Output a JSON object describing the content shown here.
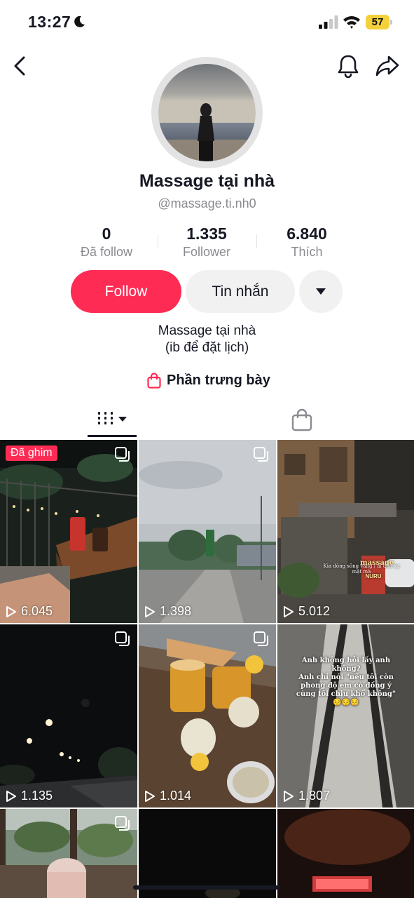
{
  "status": {
    "time": "13:27",
    "battery": "57"
  },
  "profile": {
    "name": "Massage tại nhà",
    "handle": "@massage.ti.nh0",
    "stats": [
      {
        "value": "0",
        "label": "Đã follow"
      },
      {
        "value": "1.335",
        "label": "Follower"
      },
      {
        "value": "6.840",
        "label": "Thích"
      }
    ],
    "follow_label": "Follow",
    "message_label": "Tin nhắn",
    "bio_line1": "Massage tại nhà",
    "bio_line2": "(ib để đặt lịch)",
    "showcase_label": "Phần trưng bày"
  },
  "colors": {
    "accent": "#fe2c55",
    "text": "#161823",
    "muted": "#8a8b91",
    "button_bg": "#f1f1f2"
  },
  "videos": [
    {
      "views": "6.045",
      "pinned_label": "Đã ghim",
      "multi": true
    },
    {
      "views": "1.398",
      "multi": true
    },
    {
      "views": "5.012",
      "sign_text": "massage",
      "sign_sub": "NURU",
      "caption": "Kia dòng sông vắng / ai đón xa mặt mà"
    },
    {
      "views": "1.135",
      "multi": true
    },
    {
      "views": "1.014",
      "multi": true
    },
    {
      "views": "1.807",
      "caption1": "Anh không hỏi lấy anh không?",
      "caption2": "Anh chỉ nói \"nếu tôi còn phong độ em có đồng ý cùng tôi chịu khổ không\" 😔😔😔"
    },
    {
      "views": ""
    },
    {
      "views": ""
    },
    {
      "views": ""
    }
  ],
  "icons": [
    "moon-icon",
    "signal-icon",
    "wifi-icon",
    "back-icon",
    "bell-icon",
    "share-icon",
    "shopping-bag-icon",
    "grid-icon",
    "chevron-down-icon",
    "play-icon",
    "multi-photo-icon"
  ]
}
